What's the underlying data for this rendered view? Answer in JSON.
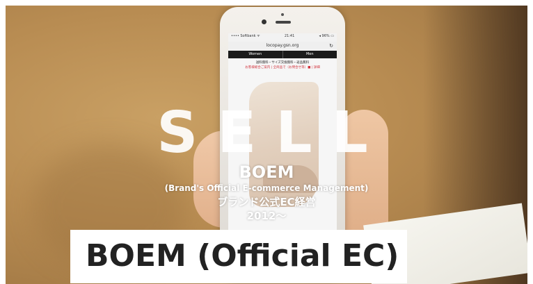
{
  "phone_screen": {
    "status_carrier": "•••• Softbank ᯤ",
    "status_time": "21:41",
    "status_battery": "◂ 96% ▭",
    "url": "locopay.gsn.org",
    "tabs": [
      "Women",
      "Men"
    ],
    "shipping_line": "送料無料・サイズ交換無料・返品無料",
    "notice_line": "お客様総合ご案内 | 全商品で（お問合せ等）■ | 詳細"
  },
  "overlay": {
    "big_word": "SELL",
    "title": "BOEM",
    "subtitle": "(Brand's Official E-commerce Management)",
    "japanese": "ブランド公式EC経営",
    "year": "2012〜"
  },
  "caption": {
    "text": "BOEM (Official EC)"
  },
  "colors": {
    "background_wood": "#b88c52",
    "caption_bg": "#ffffff",
    "caption_text": "#222222",
    "phone_tab_bg": "#1b1b1b",
    "notice_red": "#d0303a"
  }
}
